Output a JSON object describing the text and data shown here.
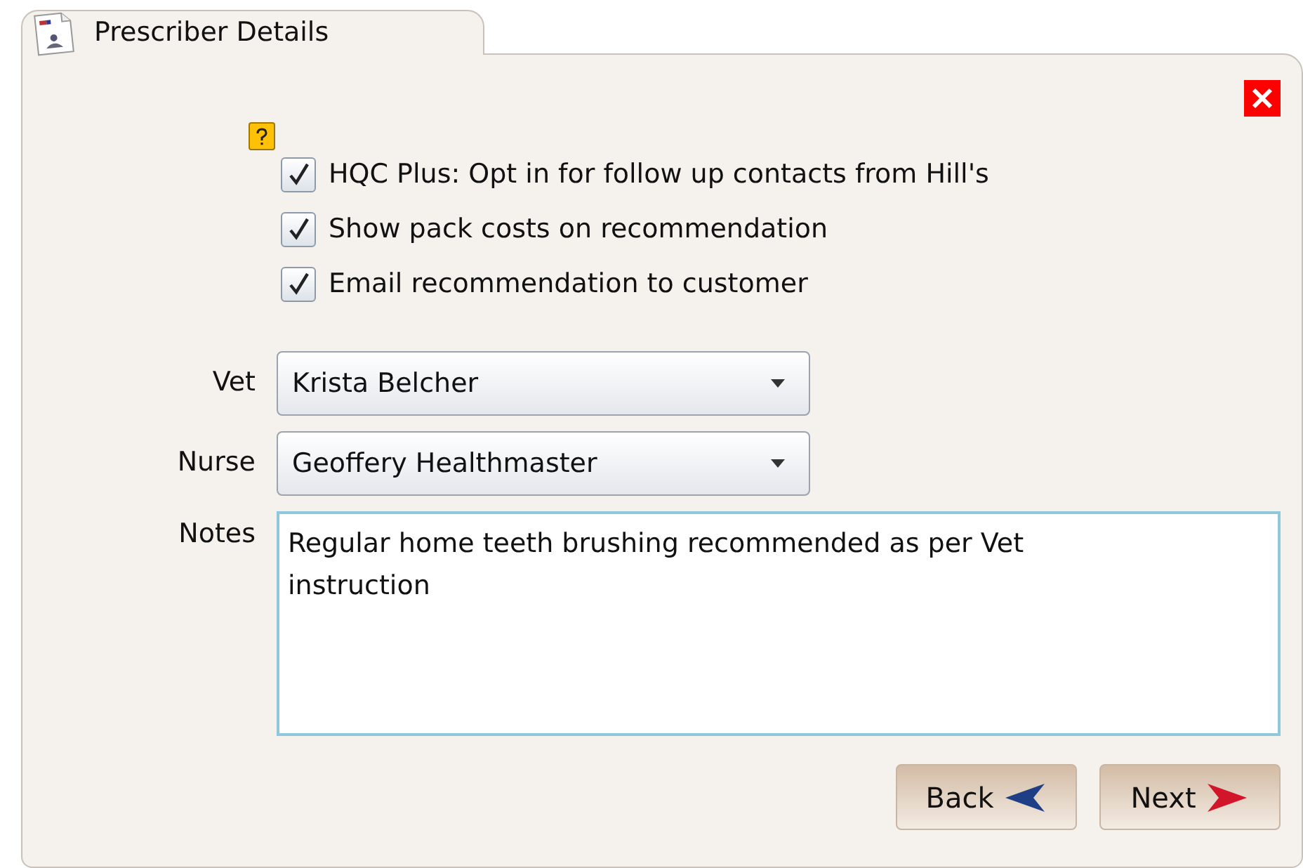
{
  "tab": {
    "title": "Prescriber Details"
  },
  "options": [
    {
      "label": "HQC Plus: Opt in for follow up contacts from Hill's",
      "checked": true
    },
    {
      "label": "Show pack costs on recommendation",
      "checked": true
    },
    {
      "label": "Email recommendation to customer",
      "checked": true
    }
  ],
  "fields": [
    {
      "label": "Vet",
      "kind": "dropdown",
      "value": "Krista Belcher"
    },
    {
      "label": "Nurse",
      "kind": "dropdown",
      "value": "Geoffery Healthmaster"
    },
    {
      "label": "Notes",
      "kind": "textarea",
      "value": "Regular home teeth brushing recommended as per Vet instruction"
    }
  ],
  "buttons": [
    {
      "label": "Back",
      "kind": "back"
    },
    {
      "label": "Next",
      "kind": "next"
    }
  ]
}
